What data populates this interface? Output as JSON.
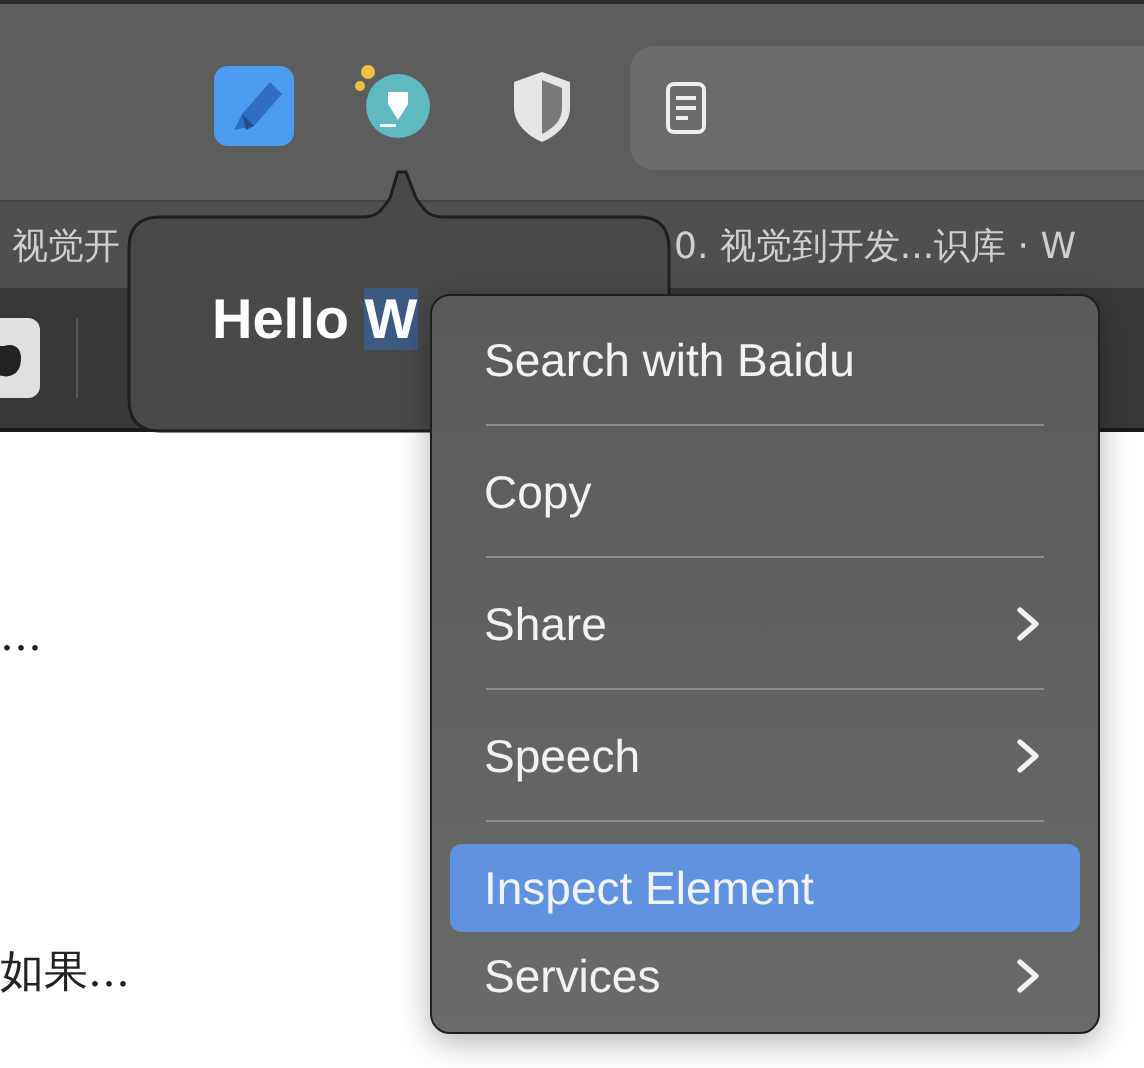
{
  "tabs": [
    {
      "label": "视觉开",
      "selected": false
    },
    {
      "label": "0. 视觉到开发...识库 · W",
      "selected": false
    }
  ],
  "popover": {
    "text": "Hello",
    "selected_text": "W"
  },
  "page": {
    "lines": [
      "...",
      "如果..."
    ]
  },
  "context_menu": {
    "items": [
      {
        "kind": "item",
        "label": "Search with Baidu",
        "submenu": false,
        "selected": false
      },
      {
        "kind": "separator"
      },
      {
        "kind": "item",
        "label": "Copy",
        "submenu": false,
        "selected": false
      },
      {
        "kind": "separator"
      },
      {
        "kind": "item",
        "label": "Share",
        "submenu": true,
        "selected": false
      },
      {
        "kind": "separator"
      },
      {
        "kind": "item",
        "label": "Speech",
        "submenu": true,
        "selected": false
      },
      {
        "kind": "separator"
      },
      {
        "kind": "item",
        "label": "Inspect Element",
        "submenu": false,
        "selected": true
      },
      {
        "kind": "item",
        "label": "Services",
        "submenu": true,
        "selected": false
      }
    ]
  }
}
